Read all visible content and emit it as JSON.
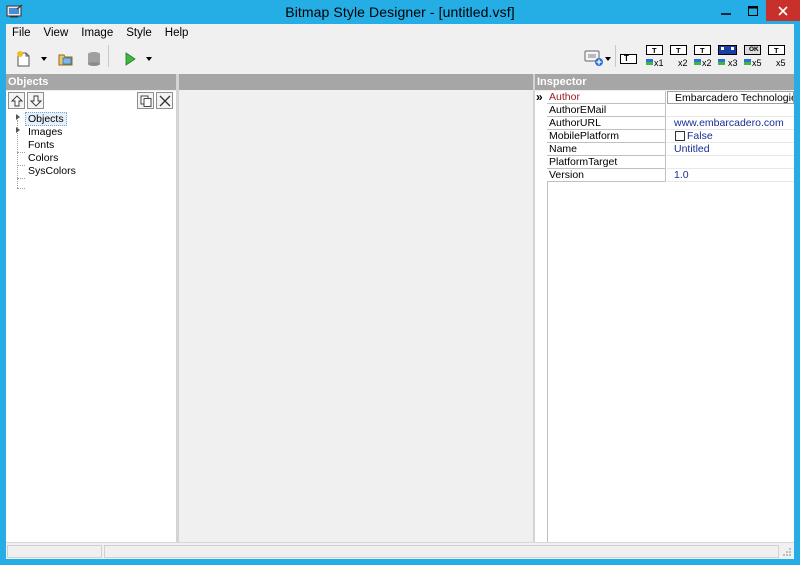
{
  "window": {
    "title": "Bitmap Style Designer - [untitled.vsf]"
  },
  "menu": {
    "items": [
      "File",
      "View",
      "Image",
      "Style",
      "Help"
    ]
  },
  "toolbar": {
    "preview_labels": [
      "T",
      "T",
      "T",
      "T",
      "T",
      "T",
      "T"
    ],
    "preview_suffixes": [
      "",
      "x1",
      "x2",
      "x2",
      "x3",
      "x5",
      "x5"
    ],
    "ok_label": "OK"
  },
  "objects_panel": {
    "header": "Objects",
    "tree": [
      {
        "label": "Objects",
        "expandable": true,
        "selected": true
      },
      {
        "label": "Images",
        "expandable": true,
        "selected": false
      },
      {
        "label": "Fonts",
        "expandable": false,
        "selected": false
      },
      {
        "label": "Colors",
        "expandable": false,
        "selected": false
      },
      {
        "label": "SysColors",
        "expandable": false,
        "selected": false
      }
    ]
  },
  "inspector": {
    "header": "Inspector",
    "current_marker": "»",
    "rows": [
      {
        "name": "Author",
        "value": "Embarcadero Technologies Inc.",
        "active": true
      },
      {
        "name": "AuthorEMail",
        "value": "",
        "active": false
      },
      {
        "name": "AuthorURL",
        "value": "www.embarcadero.com",
        "active": false
      },
      {
        "name": "MobilePlatform",
        "value": "False",
        "active": false,
        "checkbox": true
      },
      {
        "name": "Name",
        "value": "Untitled",
        "active": false
      },
      {
        "name": "PlatformTarget",
        "value": "",
        "active": false
      },
      {
        "name": "Version",
        "value": "1.0",
        "active": false
      }
    ]
  },
  "colors": {
    "titlebar": "#25aee6",
    "close_button": "#c7302b",
    "panel_header": "#a6a6a6",
    "active_property": "#9c1b1b",
    "value_text": "#1a2d98"
  }
}
